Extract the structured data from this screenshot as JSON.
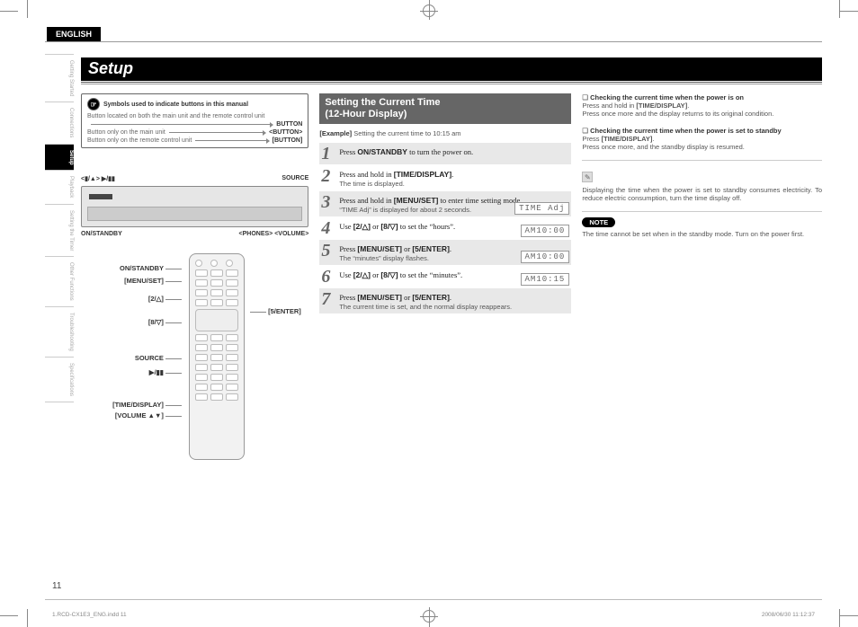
{
  "header": {
    "language_tab": "ENGLISH",
    "setup_title": "Setup"
  },
  "side_nav": [
    "Getting Started",
    "Connections",
    "Setup",
    "Playback",
    "Setting the Timer",
    "Other Functions",
    "Troubleshooting",
    "Specifications"
  ],
  "legend": {
    "title": "Symbols used to indicate buttons in this manual",
    "desc": "Button located on both the main unit and the remote control unit",
    "r1_left": "Button only on the main unit",
    "r2_left": "Button only on the remote control unit",
    "r0_lbl": "BUTTON",
    "r1_lbl": "<BUTTON>",
    "r2_lbl": "[BUTTON]"
  },
  "device": {
    "top_left": "<▮/▲>  ▶/▮▮",
    "top_right": "SOURCE",
    "bottom_left": "ON/STANDBY",
    "bottom_right": "<PHONES> <VOLUME>"
  },
  "remote_labels": {
    "l0": "ON/STANDBY",
    "l1": "[MENU/SET]",
    "l2": "[2/△]",
    "l3": "[8/▽]",
    "r0": "[5/ENTER]",
    "l4": "SOURCE",
    "l5": "▶/▮▮",
    "l6": "[TIME/DISPLAY]",
    "l7": "[VOLUME ▲▼]"
  },
  "section2": {
    "title_l1": "Setting the Current Time",
    "title_l2": "(12-Hour Display)",
    "example_lbl": "[Example]",
    "example_txt": "Setting the current time to 10:15 am",
    "steps": [
      {
        "n": "1",
        "main_pre": "Press ",
        "main_b": "ON/STANDBY",
        "main_post": " to turn the power on.",
        "sub": "",
        "lcd": ""
      },
      {
        "n": "2",
        "main_pre": "Press and hold in ",
        "main_b": "[TIME/DISPLAY]",
        "main_post": ".",
        "sub": "The time is displayed.",
        "lcd": ""
      },
      {
        "n": "3",
        "main_pre": "Press and hold in ",
        "main_b": "[MENU/SET]",
        "main_post": " to enter time setting mode.",
        "sub": "“TIME Adj” is displayed for about 2 seconds.",
        "lcd": "TIME Adj"
      },
      {
        "n": "4",
        "main_pre": "Use ",
        "main_b": "[2/△]",
        "main_mid": " or ",
        "main_b2": "[8/▽]",
        "main_post": " to set the “hours”.",
        "sub": "",
        "lcd": "AM10:00"
      },
      {
        "n": "5",
        "main_pre": "Press ",
        "main_b": "[MENU/SET]",
        "main_mid": " or ",
        "main_b2": "[5/ENTER]",
        "main_post": ".",
        "sub": "The “minutes” display flashes.",
        "lcd": "AM10:00"
      },
      {
        "n": "6",
        "main_pre": "Use ",
        "main_b": "[2/△]",
        "main_mid": " or ",
        "main_b2": "[8/▽]",
        "main_post": " to set the “minutes”.",
        "sub": "",
        "lcd": "AM10:15"
      },
      {
        "n": "7",
        "main_pre": "Press ",
        "main_b": "[MENU/SET]",
        "main_mid": " or ",
        "main_b2": "[5/ENTER]",
        "main_post": ".",
        "sub": "The current time is set, and the normal display reappears.",
        "lcd": ""
      }
    ]
  },
  "col3": {
    "b1_title": "Checking the current time when the power is on",
    "b1_l1_pre": "Press and hold in ",
    "b1_l1_b": "[TIME/DISPLAY]",
    "b1_l1_post": ".",
    "b1_l2": "Press once more and the display returns to its original condition.",
    "b2_title": "Checking the current time when the power is set to standby",
    "b2_l1_pre": "Press ",
    "b2_l1_b": "[TIME/DISPLAY]",
    "b2_l1_post": ".",
    "b2_l2": "Press once more, and the standby display is resumed.",
    "pencil_txt": "Displaying the time when the power is set to standby consumes electricity. To reduce electric consumption, turn the time display off.",
    "note_lbl": "NOTE",
    "note_txt": "The time cannot be set when in the standby mode. Turn on the power first."
  },
  "footer": {
    "page": "11",
    "left": "1.RCD-CX1E3_ENG.indd   11",
    "right": "2008/06/30   11:12:37"
  }
}
